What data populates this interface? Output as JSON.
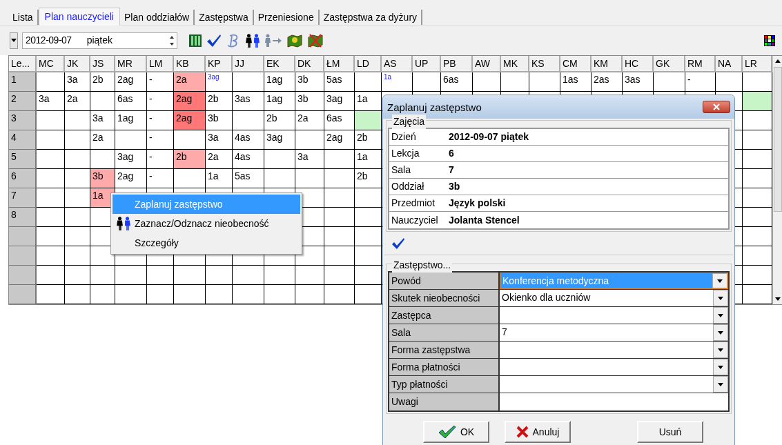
{
  "tabs": [
    {
      "label": "Lista",
      "selected": false
    },
    {
      "label": "Plan nauczycieli",
      "selected": true
    },
    {
      "label": "Plan oddziałów",
      "selected": false
    },
    {
      "label": "Zastępstwa",
      "selected": false
    },
    {
      "label": "Przeniesione",
      "selected": false
    },
    {
      "label": "Zastępstwa za dyżury",
      "selected": false
    }
  ],
  "toolbar": {
    "date": "2012-09-07",
    "day": "piątek"
  },
  "grid": {
    "corner": "Le...",
    "columns": [
      "MC",
      "JK",
      "JS",
      "MR",
      "LM",
      "KB",
      "KP",
      "JJ",
      "EK",
      "DK",
      "ŁM",
      "LD",
      "AS",
      "UP",
      "PB",
      "AW",
      "MK",
      "KS",
      "CM",
      "KM",
      "HC",
      "GK",
      "RM",
      "NA",
      "LR"
    ],
    "rows": [
      {
        "label": "1",
        "cells": [
          {},
          {
            "text": "3a"
          },
          {
            "text": "2b"
          },
          {
            "text": "2ag"
          },
          {
            "text": "-"
          },
          {
            "text": "2a",
            "color": "#ffaaaa"
          },
          {
            "text": "3ag",
            "kind": "small"
          },
          {},
          {
            "text": "1ag"
          },
          {
            "text": "3b"
          },
          {
            "text": "5as"
          },
          {},
          {
            "text": "1a",
            "kind": "small"
          },
          {},
          {
            "text": "6as"
          },
          {},
          {},
          {},
          {
            "text": "1as"
          },
          {
            "text": "2as"
          },
          {
            "text": "3as"
          },
          {},
          {
            "text": "-"
          },
          {},
          {}
        ]
      },
      {
        "label": "2",
        "cells": [
          {
            "text": "3a"
          },
          {
            "text": "2a"
          },
          {},
          {
            "text": "6as"
          },
          {
            "text": "-"
          },
          {
            "text": "2ag",
            "color": "#ff7777"
          },
          {
            "text": "2b"
          },
          {
            "text": "3as"
          },
          {
            "text": "1ag"
          },
          {
            "text": "3b"
          },
          {
            "text": "3ag"
          },
          {
            "text": "1a"
          },
          {},
          {},
          {},
          {},
          {},
          {},
          {},
          {},
          {},
          {},
          {},
          {},
          {
            "color": "#c8f5c8"
          }
        ]
      },
      {
        "label": "3",
        "cells": [
          {},
          {},
          {
            "text": "3a"
          },
          {
            "text": "1ag"
          },
          {
            "text": "-"
          },
          {
            "text": "2ag",
            "color": "#ff7777"
          },
          {
            "text": "3b"
          },
          {},
          {
            "text": "2b"
          },
          {
            "text": "2a"
          },
          {
            "text": "6as"
          },
          {
            "color": "#c8f5c8"
          }
        ]
      },
      {
        "label": "4",
        "cells": [
          {},
          {},
          {
            "text": "2a"
          },
          {},
          {
            "text": "-"
          },
          {},
          {
            "text": "3a"
          },
          {
            "text": "4as"
          },
          {
            "text": "3ag"
          },
          {},
          {
            "text": "2ag"
          },
          {
            "text": "2b"
          }
        ]
      },
      {
        "label": "5",
        "cells": [
          {},
          {},
          {},
          {
            "text": "3ag"
          },
          {
            "text": "-"
          },
          {
            "text": "2b",
            "color": "#ffaaaa"
          },
          {
            "text": "2a"
          },
          {
            "text": "4as"
          },
          {},
          {
            "text": "3a"
          },
          {},
          {
            "text": "1a"
          }
        ]
      },
      {
        "label": "6",
        "cells": [
          {},
          {},
          {
            "text": "3b",
            "color": "#ffaaaa"
          },
          {
            "text": "2ag"
          },
          {
            "text": "-"
          },
          {},
          {
            "text": "1a"
          },
          {
            "text": "5as"
          },
          {},
          {},
          {},
          {
            "text": "2b"
          }
        ]
      },
      {
        "label": "7",
        "cells": [
          {},
          {},
          {
            "text": "1a",
            "color": "#ffaaaa"
          }
        ]
      },
      {
        "label": "8",
        "cells": []
      },
      {
        "cells": []
      },
      {
        "cells": []
      },
      {
        "cells": []
      },
      {
        "cells": []
      }
    ]
  },
  "context_menu": {
    "items": [
      {
        "label": "Zaplanuj zastępstwo",
        "selected": true,
        "kind": "plain"
      },
      {
        "label": "Zaznacz/Odznacz nieobecność",
        "selected": false,
        "kind": "absence"
      },
      {
        "label": "Szczegóły",
        "selected": false,
        "kind": "plain"
      }
    ]
  },
  "dialog": {
    "title": "Zaplanuj zastępstwo",
    "lesson": {
      "title": "Zajęcia",
      "fields": [
        {
          "label": "Dzień",
          "value": "2012-09-07 piątek"
        },
        {
          "label": "Lekcja",
          "value": "6"
        },
        {
          "label": "Sala",
          "value": "7"
        },
        {
          "label": "Oddział",
          "value": "3b"
        },
        {
          "label": "Przedmiot",
          "value": "Język polski"
        },
        {
          "label": "Nauczyciel",
          "value": "Jolanta Stencel"
        }
      ]
    },
    "substitution": {
      "title": "Zastępstwo...",
      "fields": [
        {
          "label": "Powód",
          "value": "Konferencja metodyczna",
          "dropdown": true,
          "selected": true
        },
        {
          "label": "Skutek nieobecności",
          "value": "Okienko dla uczniów",
          "dropdown": true,
          "selected": false
        },
        {
          "label": "Zastępca",
          "dropdown": true,
          "selected": false
        },
        {
          "label": "Sala",
          "value": "7",
          "dropdown": true,
          "selected": false
        },
        {
          "label": "Forma zastępstwa",
          "dropdown": true,
          "selected": false
        },
        {
          "label": "Forma płatności",
          "dropdown": true,
          "selected": false
        },
        {
          "label": "Typ płatności",
          "dropdown": true,
          "selected": false
        },
        {
          "label": "Uwagi",
          "dropdown": false,
          "selected": false
        }
      ]
    },
    "buttons": [
      {
        "label": "OK",
        "kind": "ok"
      },
      {
        "label": "Anuluj",
        "kind": "cancel"
      },
      {
        "label": "Usuń",
        "kind": "plain"
      }
    ]
  }
}
